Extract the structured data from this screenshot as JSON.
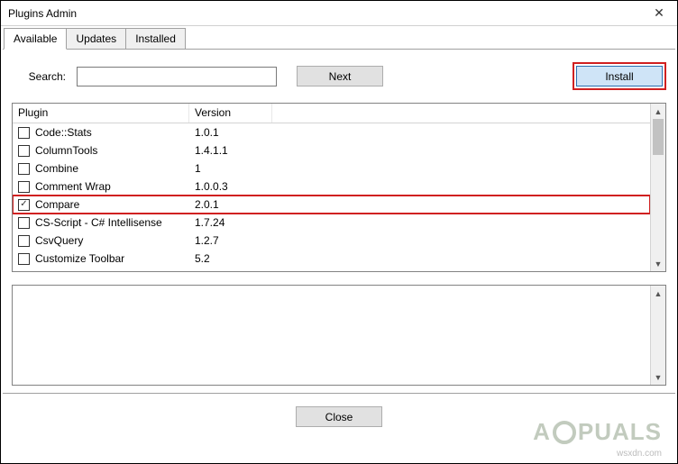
{
  "window": {
    "title": "Plugins Admin"
  },
  "tabs": {
    "available": "Available",
    "updates": "Updates",
    "installed": "Installed"
  },
  "search": {
    "label": "Search:",
    "value": "",
    "next": "Next"
  },
  "install": {
    "label": "Install"
  },
  "columns": {
    "plugin": "Plugin",
    "version": "Version"
  },
  "plugins": [
    {
      "name": "Code::Stats",
      "version": "1.0.1",
      "checked": false
    },
    {
      "name": "ColumnTools",
      "version": "1.4.1.1",
      "checked": false
    },
    {
      "name": "Combine",
      "version": "1",
      "checked": false
    },
    {
      "name": "Comment Wrap",
      "version": "1.0.0.3",
      "checked": false
    },
    {
      "name": "Compare",
      "version": "2.0.1",
      "checked": true,
      "highlight": true
    },
    {
      "name": "CS-Script - C# Intellisense",
      "version": "1.7.24",
      "checked": false
    },
    {
      "name": "CsvQuery",
      "version": "1.2.7",
      "checked": false
    },
    {
      "name": "Customize Toolbar",
      "version": "5.2",
      "checked": false
    }
  ],
  "buttons": {
    "close": "Close"
  },
  "watermark": {
    "brand": "A PUALS",
    "sub": "wsxdn.com"
  }
}
